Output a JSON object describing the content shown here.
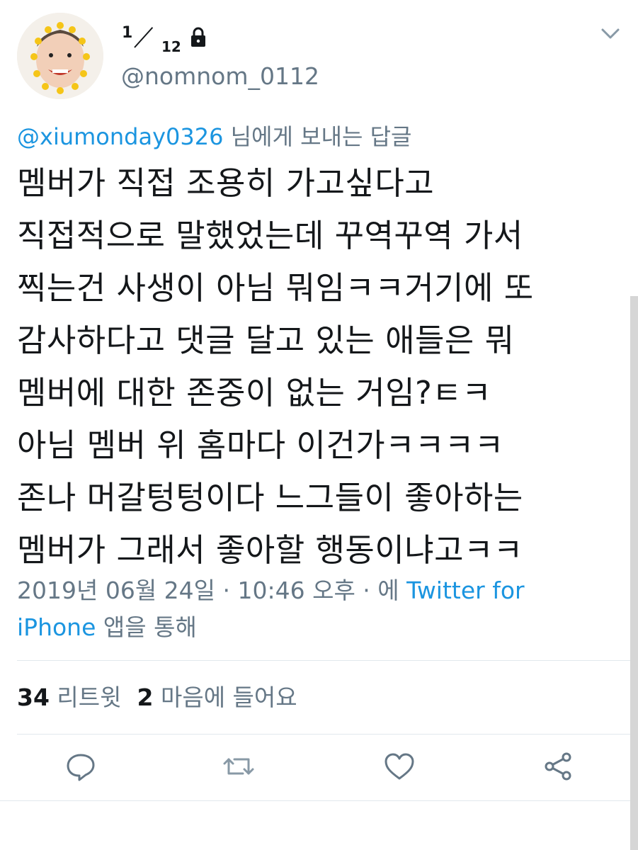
{
  "user": {
    "name_numerator": "1",
    "name_denominator": "12",
    "handle": "@nomnom_0112",
    "protected_icon": "lock-icon"
  },
  "reply_context": {
    "mention": "@xiumonday0326",
    "suffix": " 님에게 보내는 답글"
  },
  "tweet": {
    "lines": [
      "멤버가 직접 조용히 가고싶다고",
      "직접적으로 말했었는데 꾸역꾸역 가서",
      "찍는건 사생이 아님 뭐임ㅋㅋ거기에 또",
      "감사하다고 댓글 달고 있는 애들은 뭐",
      "멤버에 대한 존중이 없는 거임?ㅌㅋ",
      "아님 멤버 위 홈마다 이건가ㅋㅋㅋㅋ",
      "존나 머갈텅텅이다 느그들이 좋아하는",
      "멤버가 그래서 좋아할 행동이냐고ㅋㅋ"
    ]
  },
  "meta": {
    "timestamp": "2019년 06월 24일 · 10:46 오후 · 에 ",
    "source_link_1": "Twitter for",
    "source_link_2": "iPhone",
    "source_suffix": " 앱을 통해"
  },
  "stats": {
    "retweets_count": "34",
    "retweets_label": " 리트윗",
    "likes_count": "2",
    "likes_label": " 마음에 들어요"
  },
  "actions": {
    "reply_icon": "reply-icon",
    "retweet_icon": "retweet-icon",
    "like_icon": "heart-icon",
    "share_icon": "share-icon"
  },
  "colors": {
    "link": "#1b95e0",
    "secondary_text": "#657786",
    "primary_text": "#14171a",
    "action_icon": "#657786"
  }
}
